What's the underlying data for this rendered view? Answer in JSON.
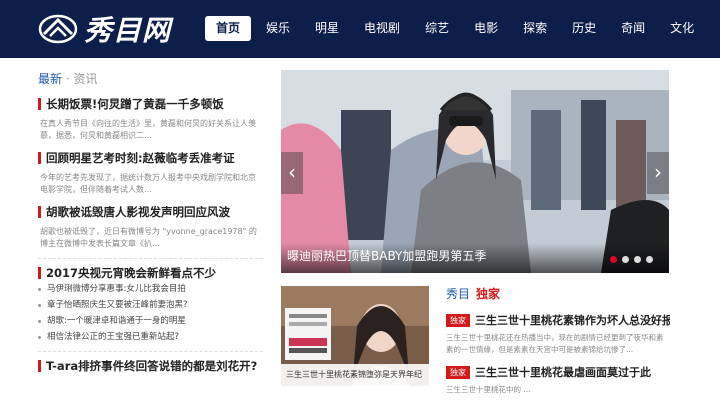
{
  "header": {
    "site_name": "秀目网",
    "nav": [
      {
        "label": "首页",
        "active": true
      },
      {
        "label": "娱乐"
      },
      {
        "label": "明星"
      },
      {
        "label": "电视剧"
      },
      {
        "label": "综艺"
      },
      {
        "label": "电影"
      },
      {
        "label": "探索"
      },
      {
        "label": "历史"
      },
      {
        "label": "奇闻"
      },
      {
        "label": "文化"
      }
    ]
  },
  "latest": {
    "title_main": "最新",
    "title_sep": "·",
    "title_sub": "资讯",
    "articles": [
      {
        "title": "长期饭票!何炅蹭了黄磊一千多顿饭",
        "desc": "在真人秀节目《向往的生活》里，黄磊和何炅的好关系让人羡慕，据悉，何炅和黄磊相识二..."
      },
      {
        "title": "回顾明星艺考时刻:赵薇临考丢准考证",
        "desc": "今年的艺考先发现了，据统计数万人报考中央戏剧学院和北京电影学院，但伴随着考试人数..."
      },
      {
        "title": "胡歌被诋毁唐人影视发声明回应风波",
        "desc": "胡歌也被诋毁了，近日有微博号为 \"yvonne_grace1978\" 的博主在微博中发表长篇文章《扒..."
      }
    ],
    "list": [
      {
        "title": "2017央视元宵晚会新鲜看点不少",
        "bold": true
      },
      {
        "title": "马伊琍微博分享惠事:女儿比我会目拍"
      },
      {
        "title": "章子怡晒照庆生又要被汪峰前妻泡黑?"
      },
      {
        "title": "胡歌:一个暖津卓和谐通于一身的明星"
      },
      {
        "title": "相信法律公正的王宝强已重新站起?"
      },
      {
        "title": "T-ara排挤事件终回答说错的都是刘花开?",
        "bold": true
      }
    ]
  },
  "slider": {
    "caption": "曝迪丽热巴顶替BABY加盟跑男第五季",
    "prev": "‹",
    "next": "›",
    "dots": 4,
    "active_dot": 0
  },
  "thumb": {
    "caption": "三生三世十里桃花素锦堕弥是天界年纪"
  },
  "exclusive": {
    "label_a": "秀目",
    "label_b": "独家",
    "items": [
      {
        "tag": "独家",
        "title": "三生三世十里桃花素锦作为坏人总没好报",
        "desc": "三生三世十里桃花还在热播当中，现在的剧情已经更到了夜华和素素的一世情缘，但是素素在天宫中可是被素锦给坑惨了..."
      },
      {
        "tag": "独家",
        "title": "三生三世十里桃花最虐画面莫过于此",
        "desc": "三生三世十里桃花中的 ..."
      }
    ]
  },
  "colors": {
    "header_bg": "#0c1f4a",
    "accent_red": "#d21a1a",
    "link_blue": "#1e5aa8"
  }
}
